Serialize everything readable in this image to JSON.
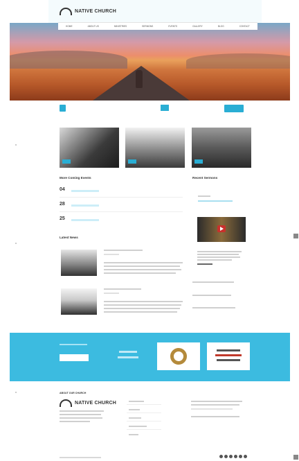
{
  "header": {
    "logo_text": "NATIVE CHURCH",
    "contact_hint": "",
    "contact_highlight": "",
    "nav": [
      "HOME",
      "ABOUT US",
      "MINISTRIES",
      "SERMONS",
      "EVENTS",
      "GALLERY",
      "BLOG",
      "CONTACT"
    ]
  },
  "countdown": {
    "label": "",
    "title": "",
    "button": ""
  },
  "thumbnails": [
    {
      "tag": "",
      "image": "worship-crowd"
    },
    {
      "tag": "",
      "image": "praying-hands"
    },
    {
      "tag": "",
      "image": "concert-stage"
    }
  ],
  "events": {
    "title": "More Coming Events",
    "items": [
      {
        "date": "04"
      },
      {
        "date": "28"
      },
      {
        "date": "25"
      }
    ]
  },
  "sermons": {
    "title": "Recent Sermons"
  },
  "news": {
    "title": "Latest News"
  },
  "band": {
    "button": ""
  },
  "footer": {
    "about_title": "ABOUT OUR CHURCH",
    "logo_text": "NATIVE CHURCH",
    "links_title": "",
    "twitter_title": ""
  },
  "colors": {
    "accent": "#2aaed4",
    "band": "#3cbbe0",
    "text": "#333333"
  }
}
